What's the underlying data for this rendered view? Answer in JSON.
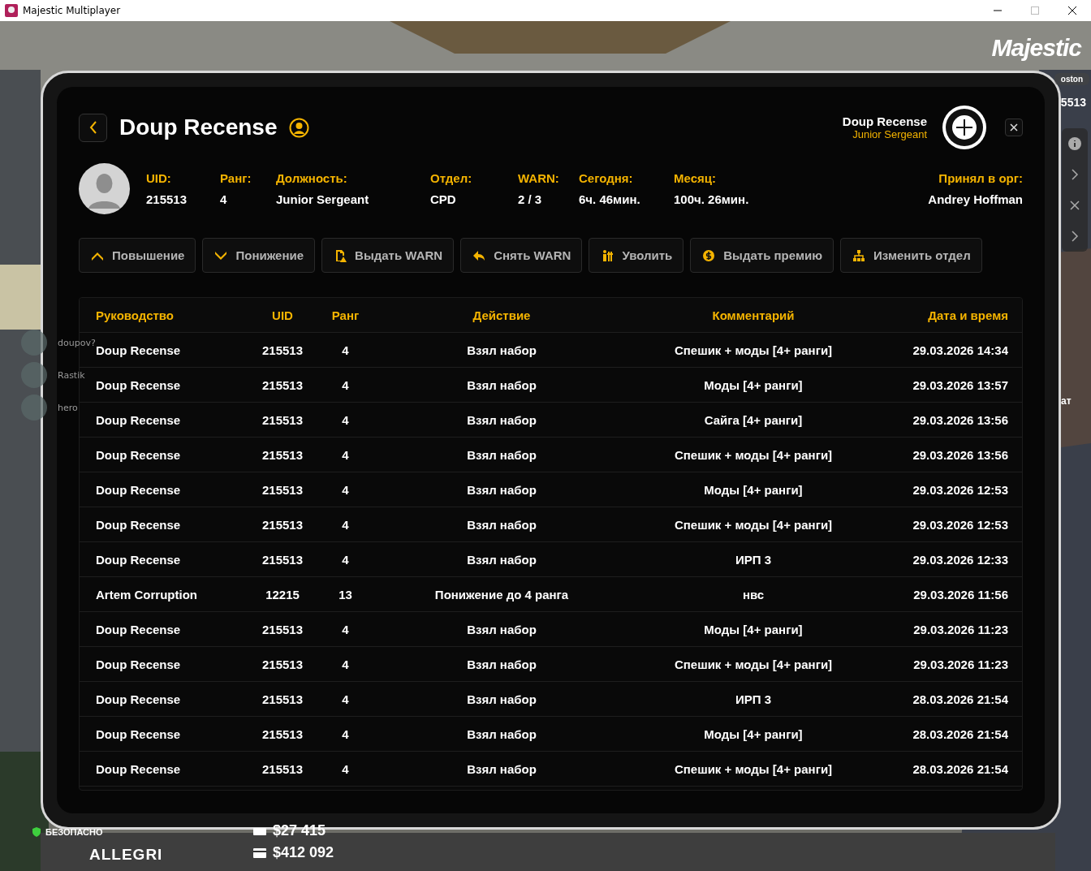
{
  "window": {
    "title": "Majestic Multiplayer"
  },
  "hud": {
    "logo": "Majestic",
    "location": "oston",
    "id_fragment": "5513",
    "side_text": "ат",
    "zone": "БЕЗОПАСНО",
    "player": "ALLEGRI",
    "cash": "$27 415",
    "bank": "$412 092"
  },
  "voice_chat": [
    {
      "name": "doupov?"
    },
    {
      "name": "Rastik"
    },
    {
      "name": "hero"
    }
  ],
  "profile": {
    "name": "Doup Recense",
    "header_name": "Doup Recense",
    "header_rank": "Junior Sergeant",
    "fields": [
      {
        "label": "UID:",
        "value": "215513"
      },
      {
        "label": "Ранг:",
        "value": "4"
      },
      {
        "label": "Должность:",
        "value": "Junior Sergeant"
      },
      {
        "label": "Отдел:",
        "value": "CPD"
      },
      {
        "label": "WARN:",
        "value": "2 / 3"
      },
      {
        "label": "Сегодня:",
        "value": "6ч. 46мин."
      },
      {
        "label": "Месяц:",
        "value": "100ч. 26мин."
      },
      {
        "label": "Принял в орг:",
        "value": "Andrey Hoffman"
      }
    ]
  },
  "actions": [
    {
      "kind": "promote",
      "label": "Повышение"
    },
    {
      "kind": "demote",
      "label": "Понижение"
    },
    {
      "kind": "warn",
      "label": "Выдать WARN"
    },
    {
      "kind": "unwarn",
      "label": "Снять WARN"
    },
    {
      "kind": "fire",
      "label": "Уволить"
    },
    {
      "kind": "bonus",
      "label": "Выдать премию"
    },
    {
      "kind": "department",
      "label": "Изменить отдел"
    }
  ],
  "table": {
    "columns": [
      "Руководство",
      "UID",
      "Ранг",
      "Действие",
      "Комментарий",
      "Дата и время"
    ],
    "rows": [
      [
        "Doup Recense",
        "215513",
        "4",
        "Взял набор",
        "Спешик + моды [4+ ранги]",
        "29.03.2026 14:34"
      ],
      [
        "Doup Recense",
        "215513",
        "4",
        "Взял набор",
        "Моды [4+ ранги]",
        "29.03.2026 13:57"
      ],
      [
        "Doup Recense",
        "215513",
        "4",
        "Взял набор",
        "Сайга [4+ ранги]",
        "29.03.2026 13:56"
      ],
      [
        "Doup Recense",
        "215513",
        "4",
        "Взял набор",
        "Спешик + моды [4+ ранги]",
        "29.03.2026 13:56"
      ],
      [
        "Doup Recense",
        "215513",
        "4",
        "Взял набор",
        "Моды [4+ ранги]",
        "29.03.2026 12:53"
      ],
      [
        "Doup Recense",
        "215513",
        "4",
        "Взял набор",
        "Спешик + моды [4+ ранги]",
        "29.03.2026 12:53"
      ],
      [
        "Doup Recense",
        "215513",
        "4",
        "Взял набор",
        "ИРП 3",
        "29.03.2026 12:33"
      ],
      [
        "Artem Corruption",
        "12215",
        "13",
        "Понижение до 4 ранга",
        "нвс",
        "29.03.2026 11:56"
      ],
      [
        "Doup Recense",
        "215513",
        "4",
        "Взял набор",
        "Моды [4+ ранги]",
        "29.03.2026 11:23"
      ],
      [
        "Doup Recense",
        "215513",
        "4",
        "Взял набор",
        "Спешик + моды [4+ ранги]",
        "29.03.2026 11:23"
      ],
      [
        "Doup Recense",
        "215513",
        "4",
        "Взял набор",
        "ИРП 3",
        "28.03.2026 21:54"
      ],
      [
        "Doup Recense",
        "215513",
        "4",
        "Взял набор",
        "Моды [4+ ранги]",
        "28.03.2026 21:54"
      ],
      [
        "Doup Recense",
        "215513",
        "4",
        "Взял набор",
        "Спешик + моды [4+ ранги]",
        "28.03.2026 21:54"
      ]
    ]
  }
}
